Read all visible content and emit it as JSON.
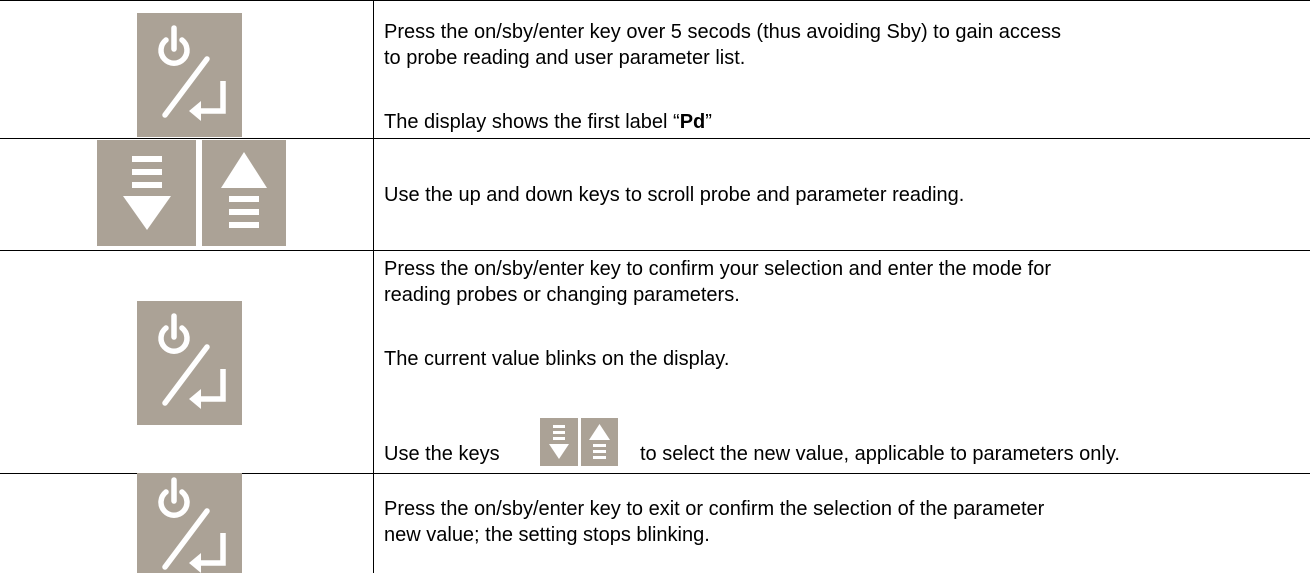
{
  "rows": [
    {
      "icon": "power-enter-key-icon",
      "lines": [
        "Press the on/sby/enter key over 5 secods (thus avoiding Sby) to gain access",
        "to probe reading and user parameter list."
      ],
      "display_prefix": "The display shows the first label “",
      "display_label": "Pd",
      "display_suffix": "”"
    },
    {
      "icons": [
        "down-scroll-key-icon",
        "up-scroll-key-icon"
      ],
      "lines": [
        "Use the up and down keys to scroll probe and parameter reading."
      ]
    },
    {
      "icon": "power-enter-key-icon",
      "lines": [
        "Press the on/sby/enter key to confirm your selection and enter the mode for",
        "reading probes or changing parameters."
      ],
      "blink_text": "The current value blinks on the display.",
      "use_prefix": "Use the keys",
      "use_suffix": "to select the new value, applicable to parameters only."
    },
    {
      "icon": "power-enter-key-icon",
      "lines": [
        "Press the on/sby/enter key to exit or confirm the selection of the parameter",
        "new value; the setting stops blinking."
      ]
    }
  ],
  "colors": {
    "key_background": "#ABA296",
    "key_symbol": "#FFFFFF",
    "border": "#000000"
  }
}
